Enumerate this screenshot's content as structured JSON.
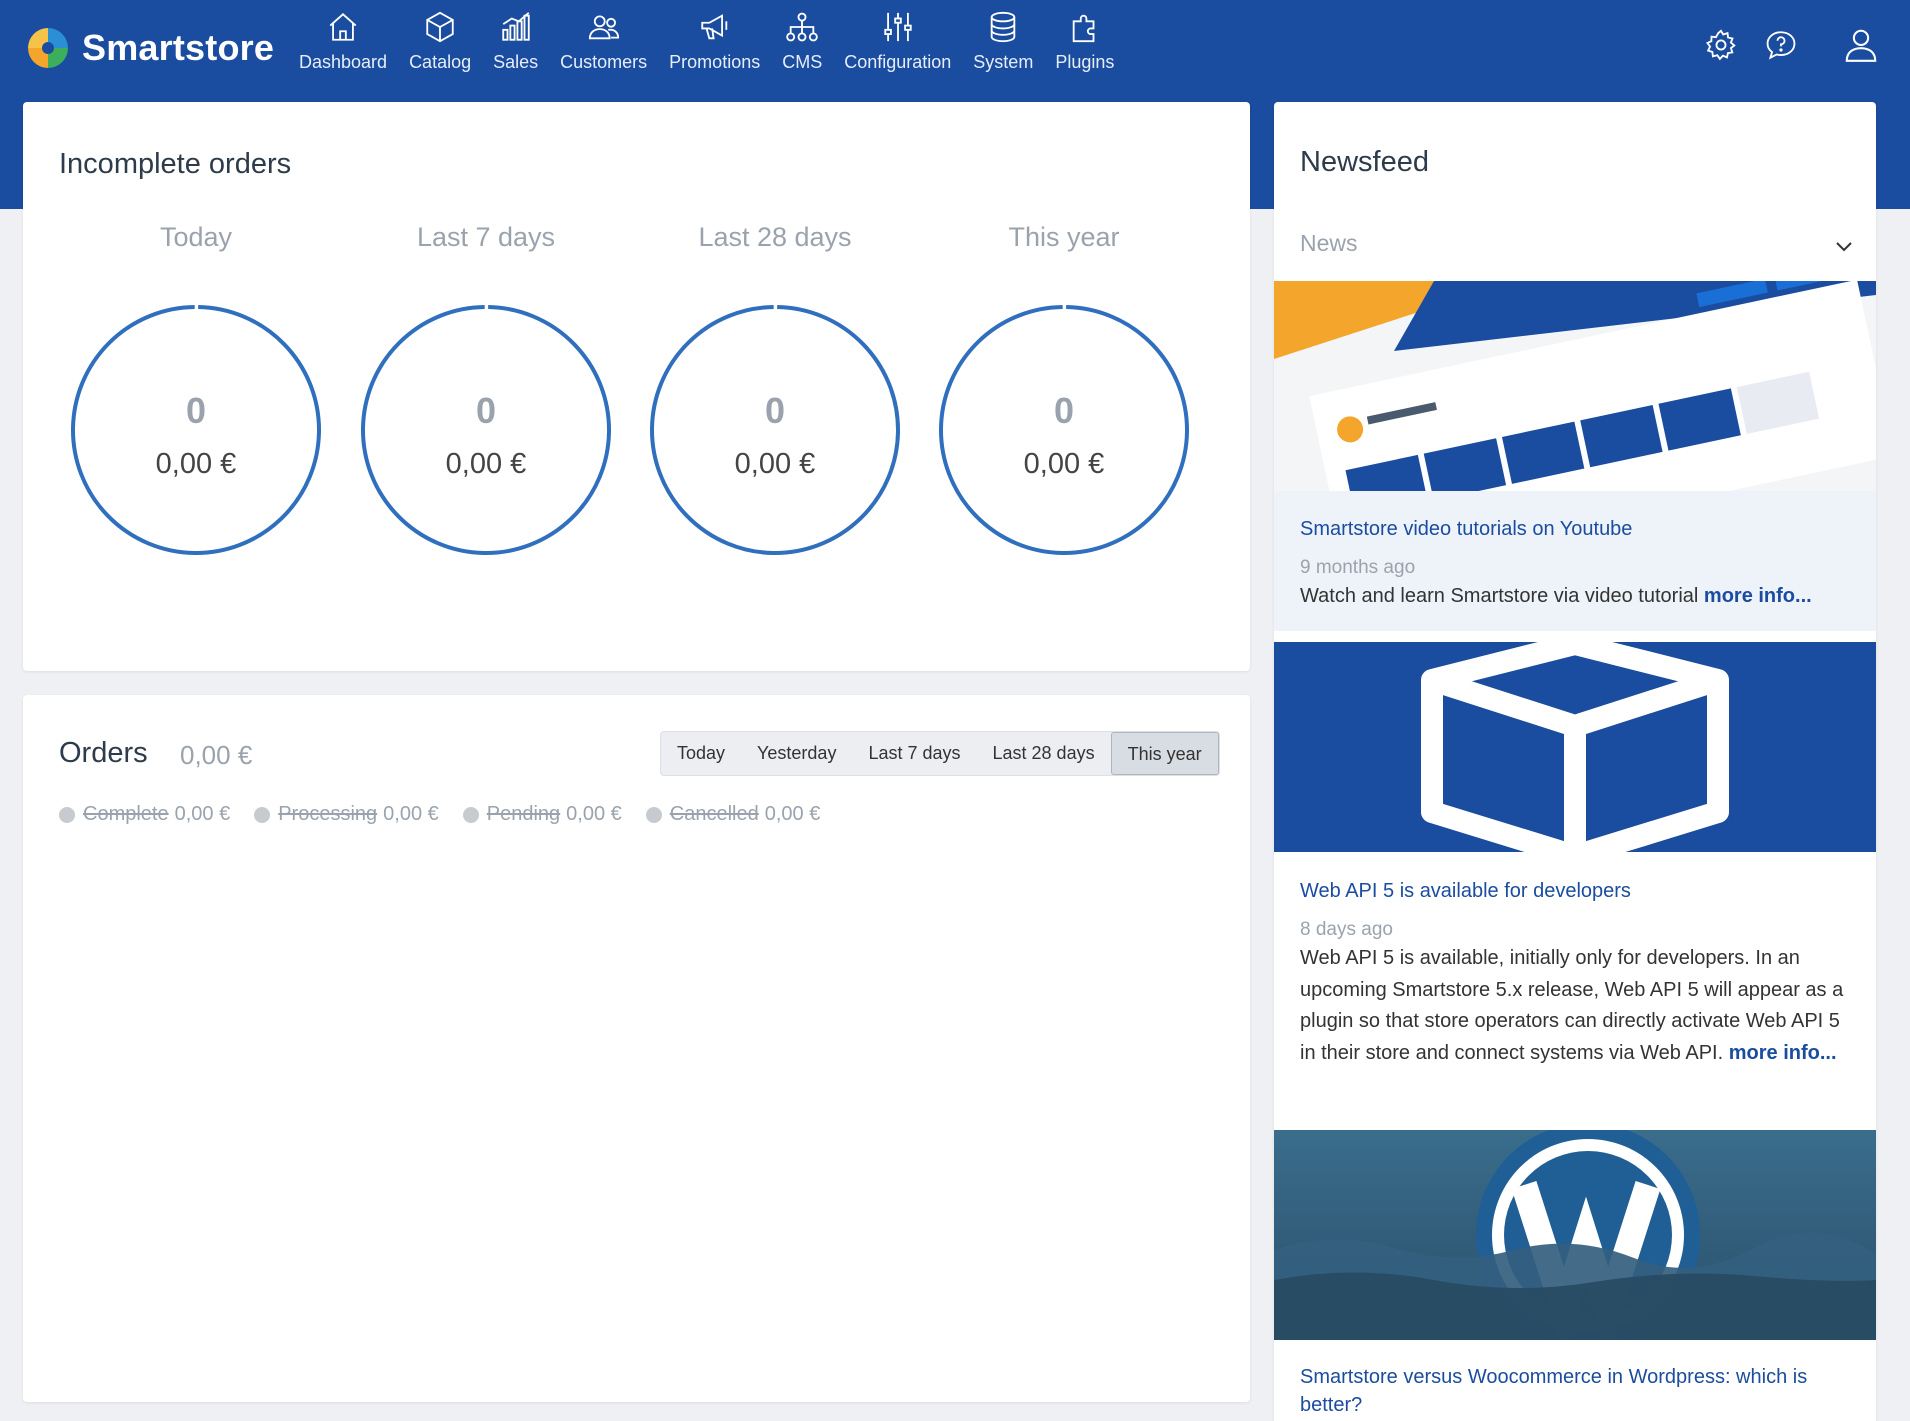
{
  "brand": {
    "name": "Smartstore"
  },
  "nav": {
    "items": [
      {
        "label": "Dashboard",
        "icon": "home-icon"
      },
      {
        "label": "Catalog",
        "icon": "cube-icon"
      },
      {
        "label": "Sales",
        "icon": "chart-icon"
      },
      {
        "label": "Customers",
        "icon": "users-icon"
      },
      {
        "label": "Promotions",
        "icon": "megaphone-icon"
      },
      {
        "label": "CMS",
        "icon": "sitemap-icon"
      },
      {
        "label": "Configuration",
        "icon": "sliders-icon"
      },
      {
        "label": "System",
        "icon": "database-icon"
      },
      {
        "label": "Plugins",
        "icon": "puzzle-icon"
      }
    ],
    "right_icons": [
      "gear-icon",
      "help-chat-icon",
      "user-icon"
    ]
  },
  "incomplete_orders": {
    "title": "Incomplete orders",
    "periods": [
      {
        "label": "Today",
        "count": "0",
        "amount": "0,00 €"
      },
      {
        "label": "Last 7 days",
        "count": "0",
        "amount": "0,00 €"
      },
      {
        "label": "Last 28 days",
        "count": "0",
        "amount": "0,00 €"
      },
      {
        "label": "This year",
        "count": "0",
        "amount": "0,00 €"
      }
    ]
  },
  "orders": {
    "title": "Orders",
    "total": "0,00 €",
    "tabs": [
      "Today",
      "Yesterday",
      "Last 7 days",
      "Last 28 days",
      "This year"
    ],
    "active_tab": "This year",
    "legend": [
      {
        "name": "Complete",
        "value": "0,00 €"
      },
      {
        "name": "Processing",
        "value": "0,00 €"
      },
      {
        "name": "Pending",
        "value": "0,00 €"
      },
      {
        "name": "Cancelled",
        "value": "0,00 €"
      }
    ]
  },
  "newsfeed": {
    "title": "Newsfeed",
    "filter": "News",
    "items": [
      {
        "title": "Smartstore video tutorials on Youtube",
        "date": "9 months ago",
        "text": "Watch and learn Smartstore via video tutorial",
        "more": "more info..."
      },
      {
        "title": "Web API 5 is available for developers",
        "date": "8 days ago",
        "text": "Web API 5 is available, initially only for developers. In an upcoming Smartstore 5.x release, Web API 5 will appear as a plugin so that store operators can directly activate Web API 5 in their store and connect systems via Web API.",
        "more": "more info..."
      },
      {
        "title": "Smartstore versus Woocommerce in Wordpress: which is better?"
      }
    ]
  },
  "colors": {
    "primary": "#1a4c9f",
    "ring": "#2f6fbd",
    "muted": "#9aa3ad",
    "background": "#eef0f3"
  }
}
